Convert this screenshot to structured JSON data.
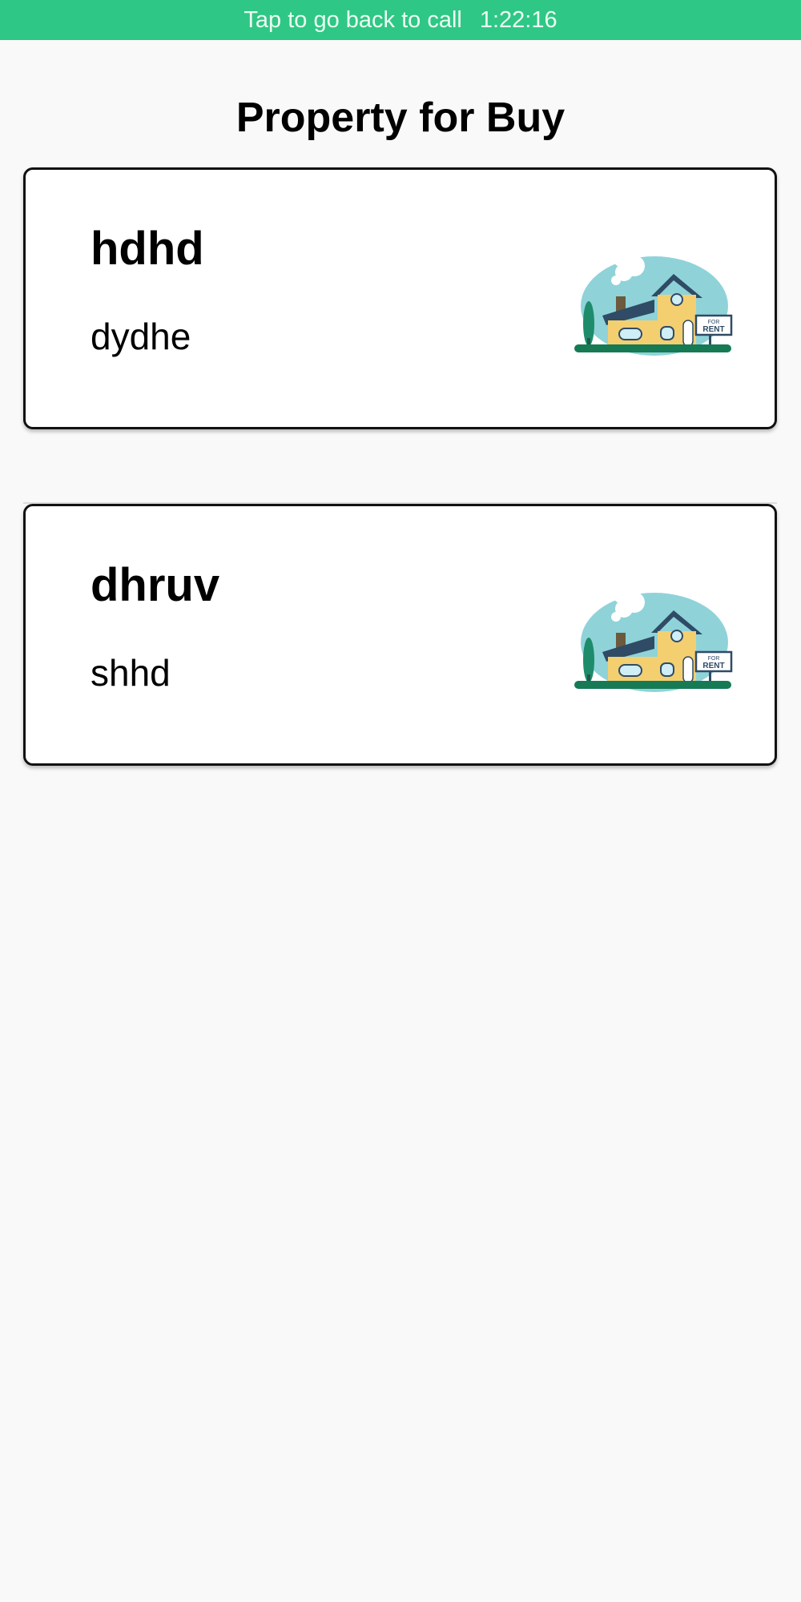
{
  "call_banner": {
    "text": "Tap to go back to call",
    "duration": "1:22:16"
  },
  "page": {
    "title": "Property for Buy"
  },
  "properties": [
    {
      "title": "hdhd",
      "description": "dydhe",
      "image_icon": "house-for-rent-illustration"
    },
    {
      "title": "dhruv",
      "description": "shhd",
      "image_icon": "house-for-rent-illustration"
    }
  ],
  "sign_text_top": "FOR",
  "sign_text_bottom": "RENT",
  "colors": {
    "banner": "#2fc785",
    "background": "#f9f9f9",
    "card_border": "#111111"
  }
}
